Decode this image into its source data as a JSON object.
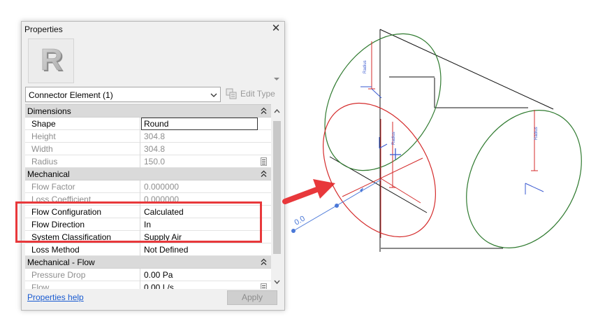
{
  "window": {
    "title": "Properties",
    "close_icon": "close-x-icon"
  },
  "preview": {
    "logo_letter": "R"
  },
  "type_selector": {
    "value": "Connector Element (1)",
    "edit_type_label": "Edit Type"
  },
  "groups": [
    {
      "label": "Dimensions",
      "rows": [
        {
          "name": "Shape",
          "value": "Round",
          "editable": true
        },
        {
          "name": "Height",
          "value": "304.8",
          "editable": false
        },
        {
          "name": "Width",
          "value": "304.8",
          "editable": false
        },
        {
          "name": "Radius",
          "value": "150.0",
          "editable": false
        }
      ]
    },
    {
      "label": "Mechanical",
      "rows": [
        {
          "name": "Flow Factor",
          "value": "0.000000",
          "editable": false
        },
        {
          "name": "Loss Coefficient",
          "value": "0.000000",
          "editable": false
        },
        {
          "name": "Flow Configuration",
          "value": "Calculated",
          "editable": true
        },
        {
          "name": "Flow Direction",
          "value": "In",
          "editable": true
        },
        {
          "name": "System Classification",
          "value": "Supply Air",
          "editable": true
        },
        {
          "name": "Loss Method",
          "value": "Not Defined",
          "editable": true
        }
      ]
    },
    {
      "label": "Mechanical - Flow",
      "rows": [
        {
          "name": "Pressure Drop",
          "value": "0.00 Pa",
          "editable": false
        },
        {
          "name": "Flow",
          "value": "0.00 L/s",
          "editable": false
        }
      ]
    }
  ],
  "footer": {
    "help_link": "Properties help",
    "apply_label": "Apply"
  },
  "drawing": {
    "radius_label": "Radius",
    "dimension_label": "0.0",
    "colors": {
      "selected_connector": "#d42b2b",
      "other_connectors": "#2f7a2f",
      "highlight_box": "#e8383b",
      "callout_arrow": "#e8383b",
      "flow_arrow": "#4a78d8"
    }
  }
}
